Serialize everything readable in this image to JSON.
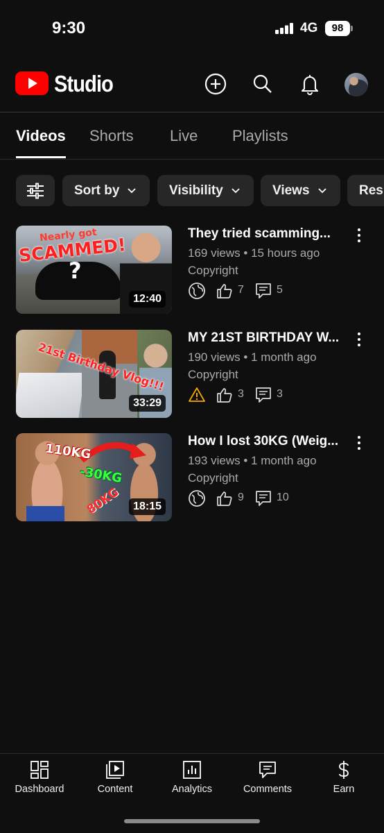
{
  "status_bar": {
    "time": "9:30",
    "network": "4G",
    "battery": "98"
  },
  "header": {
    "app_name": "Studio",
    "icons": [
      "create-icon",
      "search-icon",
      "notifications-icon",
      "avatar"
    ]
  },
  "tabs": [
    {
      "label": "Videos",
      "active": true
    },
    {
      "label": "Shorts",
      "active": false
    },
    {
      "label": "Live",
      "active": false
    },
    {
      "label": "Playlists",
      "active": false
    }
  ],
  "filters": {
    "icon": "filter-sliders-icon",
    "chips": [
      "Sort by",
      "Visibility",
      "Views",
      "Res"
    ]
  },
  "videos": [
    {
      "title": "They tried scamming...",
      "views": "169 views",
      "age": "15 hours ago",
      "restriction": "Copyright",
      "visibility_icon": "globe-icon",
      "likes": "7",
      "comments": "5",
      "duration": "12:40",
      "thumb_text_1": "Nearly got",
      "thumb_text_2": "SCAMMED!",
      "thumb_text_3": "?"
    },
    {
      "title": "MY 21ST BIRTHDAY W...",
      "views": "190 views",
      "age": "1 month ago",
      "restriction": "Copyright",
      "visibility_icon": "warning-icon",
      "likes": "3",
      "comments": "3",
      "duration": "33:29",
      "thumb_text_1": "21st Birthday Vlog!!!"
    },
    {
      "title": "How I lost 30KG (Weig...",
      "views": "193 views",
      "age": "1 month ago",
      "restriction": "Copyright",
      "visibility_icon": "globe-icon",
      "likes": "9",
      "comments": "10",
      "duration": "18:15",
      "thumb_text_1": "110KG",
      "thumb_text_2": "-30KG",
      "thumb_text_3": "80KG"
    }
  ],
  "bottom_nav": [
    {
      "label": "Dashboard",
      "icon": "dashboard-icon"
    },
    {
      "label": "Content",
      "icon": "content-icon"
    },
    {
      "label": "Analytics",
      "icon": "analytics-icon"
    },
    {
      "label": "Comments",
      "icon": "comments-icon"
    },
    {
      "label": "Earn",
      "icon": "earn-icon"
    }
  ],
  "colors": {
    "background": "#0f0f0f",
    "brand_red": "#ff0000",
    "chip": "#272727",
    "secondary_text": "#aaaaaa",
    "warning": "#f2a900"
  }
}
